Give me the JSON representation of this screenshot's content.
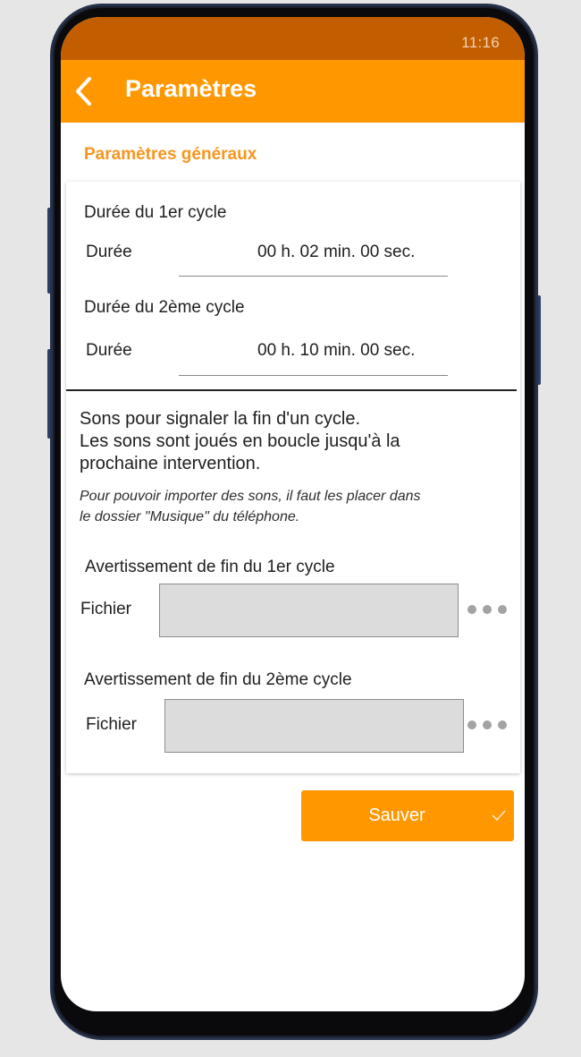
{
  "status_bar": {
    "time": "11:16"
  },
  "app_bar": {
    "title": "Paramètres",
    "back_icon": "chevron-left-icon"
  },
  "section": {
    "title": "Paramètres généraux"
  },
  "cycle1": {
    "heading": "Durée du 1er cycle",
    "label": "Durée",
    "value": "00 h. 02 min. 00 sec."
  },
  "cycle2": {
    "heading": "Durée du 2ème cycle",
    "label": "Durée",
    "value": "00 h. 10 min. 00 sec."
  },
  "sounds": {
    "description_lines": [
      "Sons pour signaler la fin d'un cycle.",
      "Les sons sont joués en boucle jusqu'à la",
      "prochaine intervention."
    ],
    "note_lines": [
      "Pour pouvoir importer des sons, il faut les placer dans",
      "le dossier \"Musique\" du téléphone."
    ],
    "alert1": {
      "heading": "Avertissement de fin du 1er cycle",
      "label": "Fichier",
      "value": "",
      "more_icon": "more-horizontal-icon"
    },
    "alert2": {
      "heading": "Avertissement de fin du 2ème cycle",
      "label": "Fichier",
      "value": "",
      "more_icon": "more-horizontal-icon"
    }
  },
  "save_button": {
    "label": "Sauver",
    "icon": "check-icon"
  },
  "colors": {
    "accent": "#ff9800",
    "status_bar": "#c25e00",
    "section_title": "#f7951d",
    "file_field": "#dcdcdc"
  }
}
